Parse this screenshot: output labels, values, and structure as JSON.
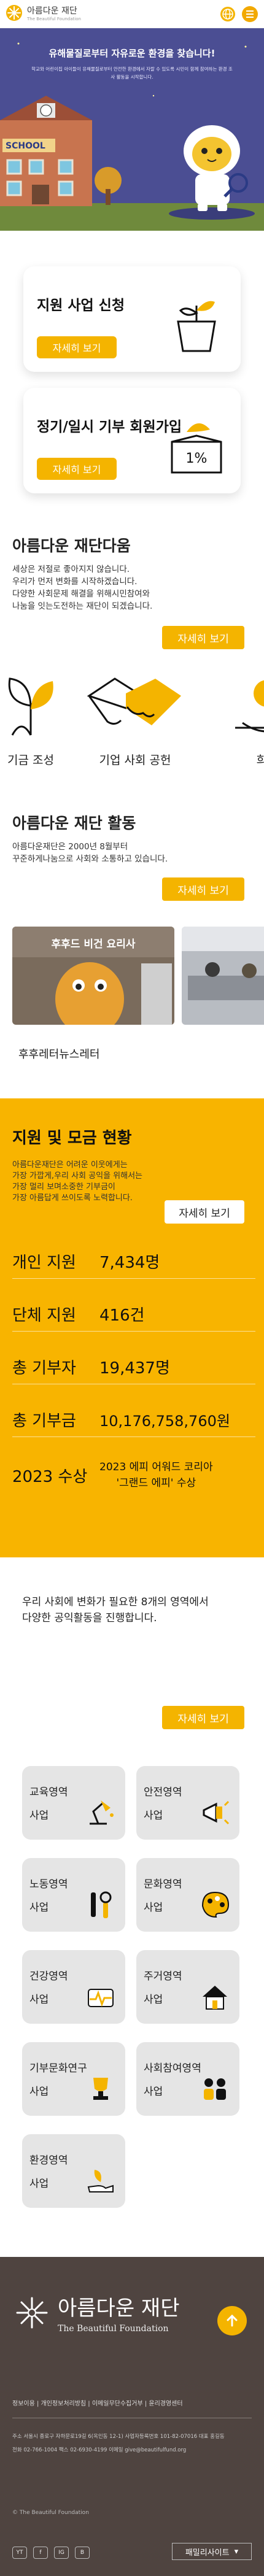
{
  "header": {
    "logo_text": "아름다운 재단",
    "logo_sub": "The Beautiful Foundation",
    "icons": [
      "globe-icon",
      "menu-icon"
    ]
  },
  "hero": {
    "title": "유해물질로부터 자유로운 환경을 찾습니다!",
    "subtitle": "학교와 어린이집 아이들이 유해물질로부터 안전한 환경에서 자랄 수 있도록 시민이 함께 참여하는 환경 조사 활동을 시작합니다.",
    "school_sign": "SCHOOL"
  },
  "cards": [
    {
      "title": "지원 사업 신청",
      "button": "자세히 보기",
      "icon": "plant-pot-icon"
    },
    {
      "title": "정기/일시 기부 회원가입",
      "button": "자세히 보기",
      "icon": "donation-box-icon",
      "badge": "1%"
    }
  ],
  "about": {
    "title": "아름다운 재단다움",
    "body": [
      "세상은 저절로 좋아지지 않습니다.",
      "우리가 먼저 변화를 시작하겠습니다.",
      "다양한 사회문제 해결을 위해시민참여와",
      "나눔을 잇는도전하는 재단이 되겠습니다."
    ],
    "button": "자세히 보기",
    "items": [
      {
        "label": "기금 조성",
        "icon": "sprout-icon"
      },
      {
        "label": "기업 사회 공헌",
        "icon": "handshake-icon"
      },
      {
        "label": "희망",
        "icon": "hope-icon"
      }
    ]
  },
  "activity": {
    "title": "아름다운 재단 활동",
    "body": [
      "아름다운재단은 2000년 8월부터",
      "꾸준하게나눔으로 사회와 소통하고 있습니다."
    ],
    "button": "자세히 보기",
    "photo_overlay": "후후드 비건 요리사",
    "caption": "후후레터뉴스레터"
  },
  "stats": {
    "title": "지원 및 모금 현황",
    "body": [
      "아름다운재단은 어려운 이웃에게는",
      "가장 가깝게,우리 사회 공익을 위해서는",
      "가장 멀리 보며소중한 기부금이",
      "가장 아름답게 쓰이도록 노력합니다."
    ],
    "button": "자세히 보기",
    "rows": [
      {
        "label": "개인 지원",
        "value": "7,434명"
      },
      {
        "label": "단체 지원",
        "value": "416건"
      },
      {
        "label": "총 기부자",
        "value": "19,437명"
      },
      {
        "label": "총 기부금",
        "value": "10,176,758,760원"
      }
    ],
    "award": {
      "label": "2023 수상",
      "line1": "2023 에피 어워드 코리아",
      "line2": "'그랜드 에피' 수상"
    }
  },
  "areas": {
    "intro": [
      "우리 사회에 변화가 필요한 8개의 영역에서",
      "다양한 공익활동을 진행합니다."
    ],
    "button": "자세히 보기",
    "items": [
      {
        "name": "교육영역",
        "suffix": "사업",
        "icon": "desk-lamp-icon"
      },
      {
        "name": "안전영역",
        "suffix": "사업",
        "icon": "megaphone-icon"
      },
      {
        "name": "노동영역",
        "suffix": "사업",
        "icon": "tools-icon"
      },
      {
        "name": "문화영역",
        "suffix": "사업",
        "icon": "palette-icon"
      },
      {
        "name": "건강영역",
        "suffix": "사업",
        "icon": "health-pulse-icon"
      },
      {
        "name": "주거영역",
        "suffix": "사업",
        "icon": "house-icon"
      },
      {
        "name": "기부문화연구",
        "suffix": "사업",
        "icon": "trophy-icon"
      },
      {
        "name": "사회참여영역",
        "suffix": "사업",
        "icon": "people-icon"
      },
      {
        "name": "환경영역",
        "suffix": "사업",
        "icon": "eco-hand-icon"
      }
    ]
  },
  "footer": {
    "logo_text": "아름다운 재단",
    "logo_sub": "The Beautiful Foundation",
    "links": "정보이용 | 개인정보처리방침 | 이메일무단수집거부 | 윤리경영센터",
    "info": [
      "주소 서울시 종로구 자하문로19길 6(옥인동 12-1) 사업자등록번호 101-82-07016 대표 홍길동",
      "전화 02-766-1004 팩스 02-6930-4199 이메일 give@beautifulfund.org"
    ],
    "copyright": "© The Beautiful Foundation",
    "social": [
      "YT",
      "f",
      "IG",
      "B"
    ],
    "family_site": "패밀리사이트",
    "colors": {
      "footer_bg": "#4f4440",
      "accent": "#f4b400",
      "hero_bg": "#4b4e93"
    }
  }
}
